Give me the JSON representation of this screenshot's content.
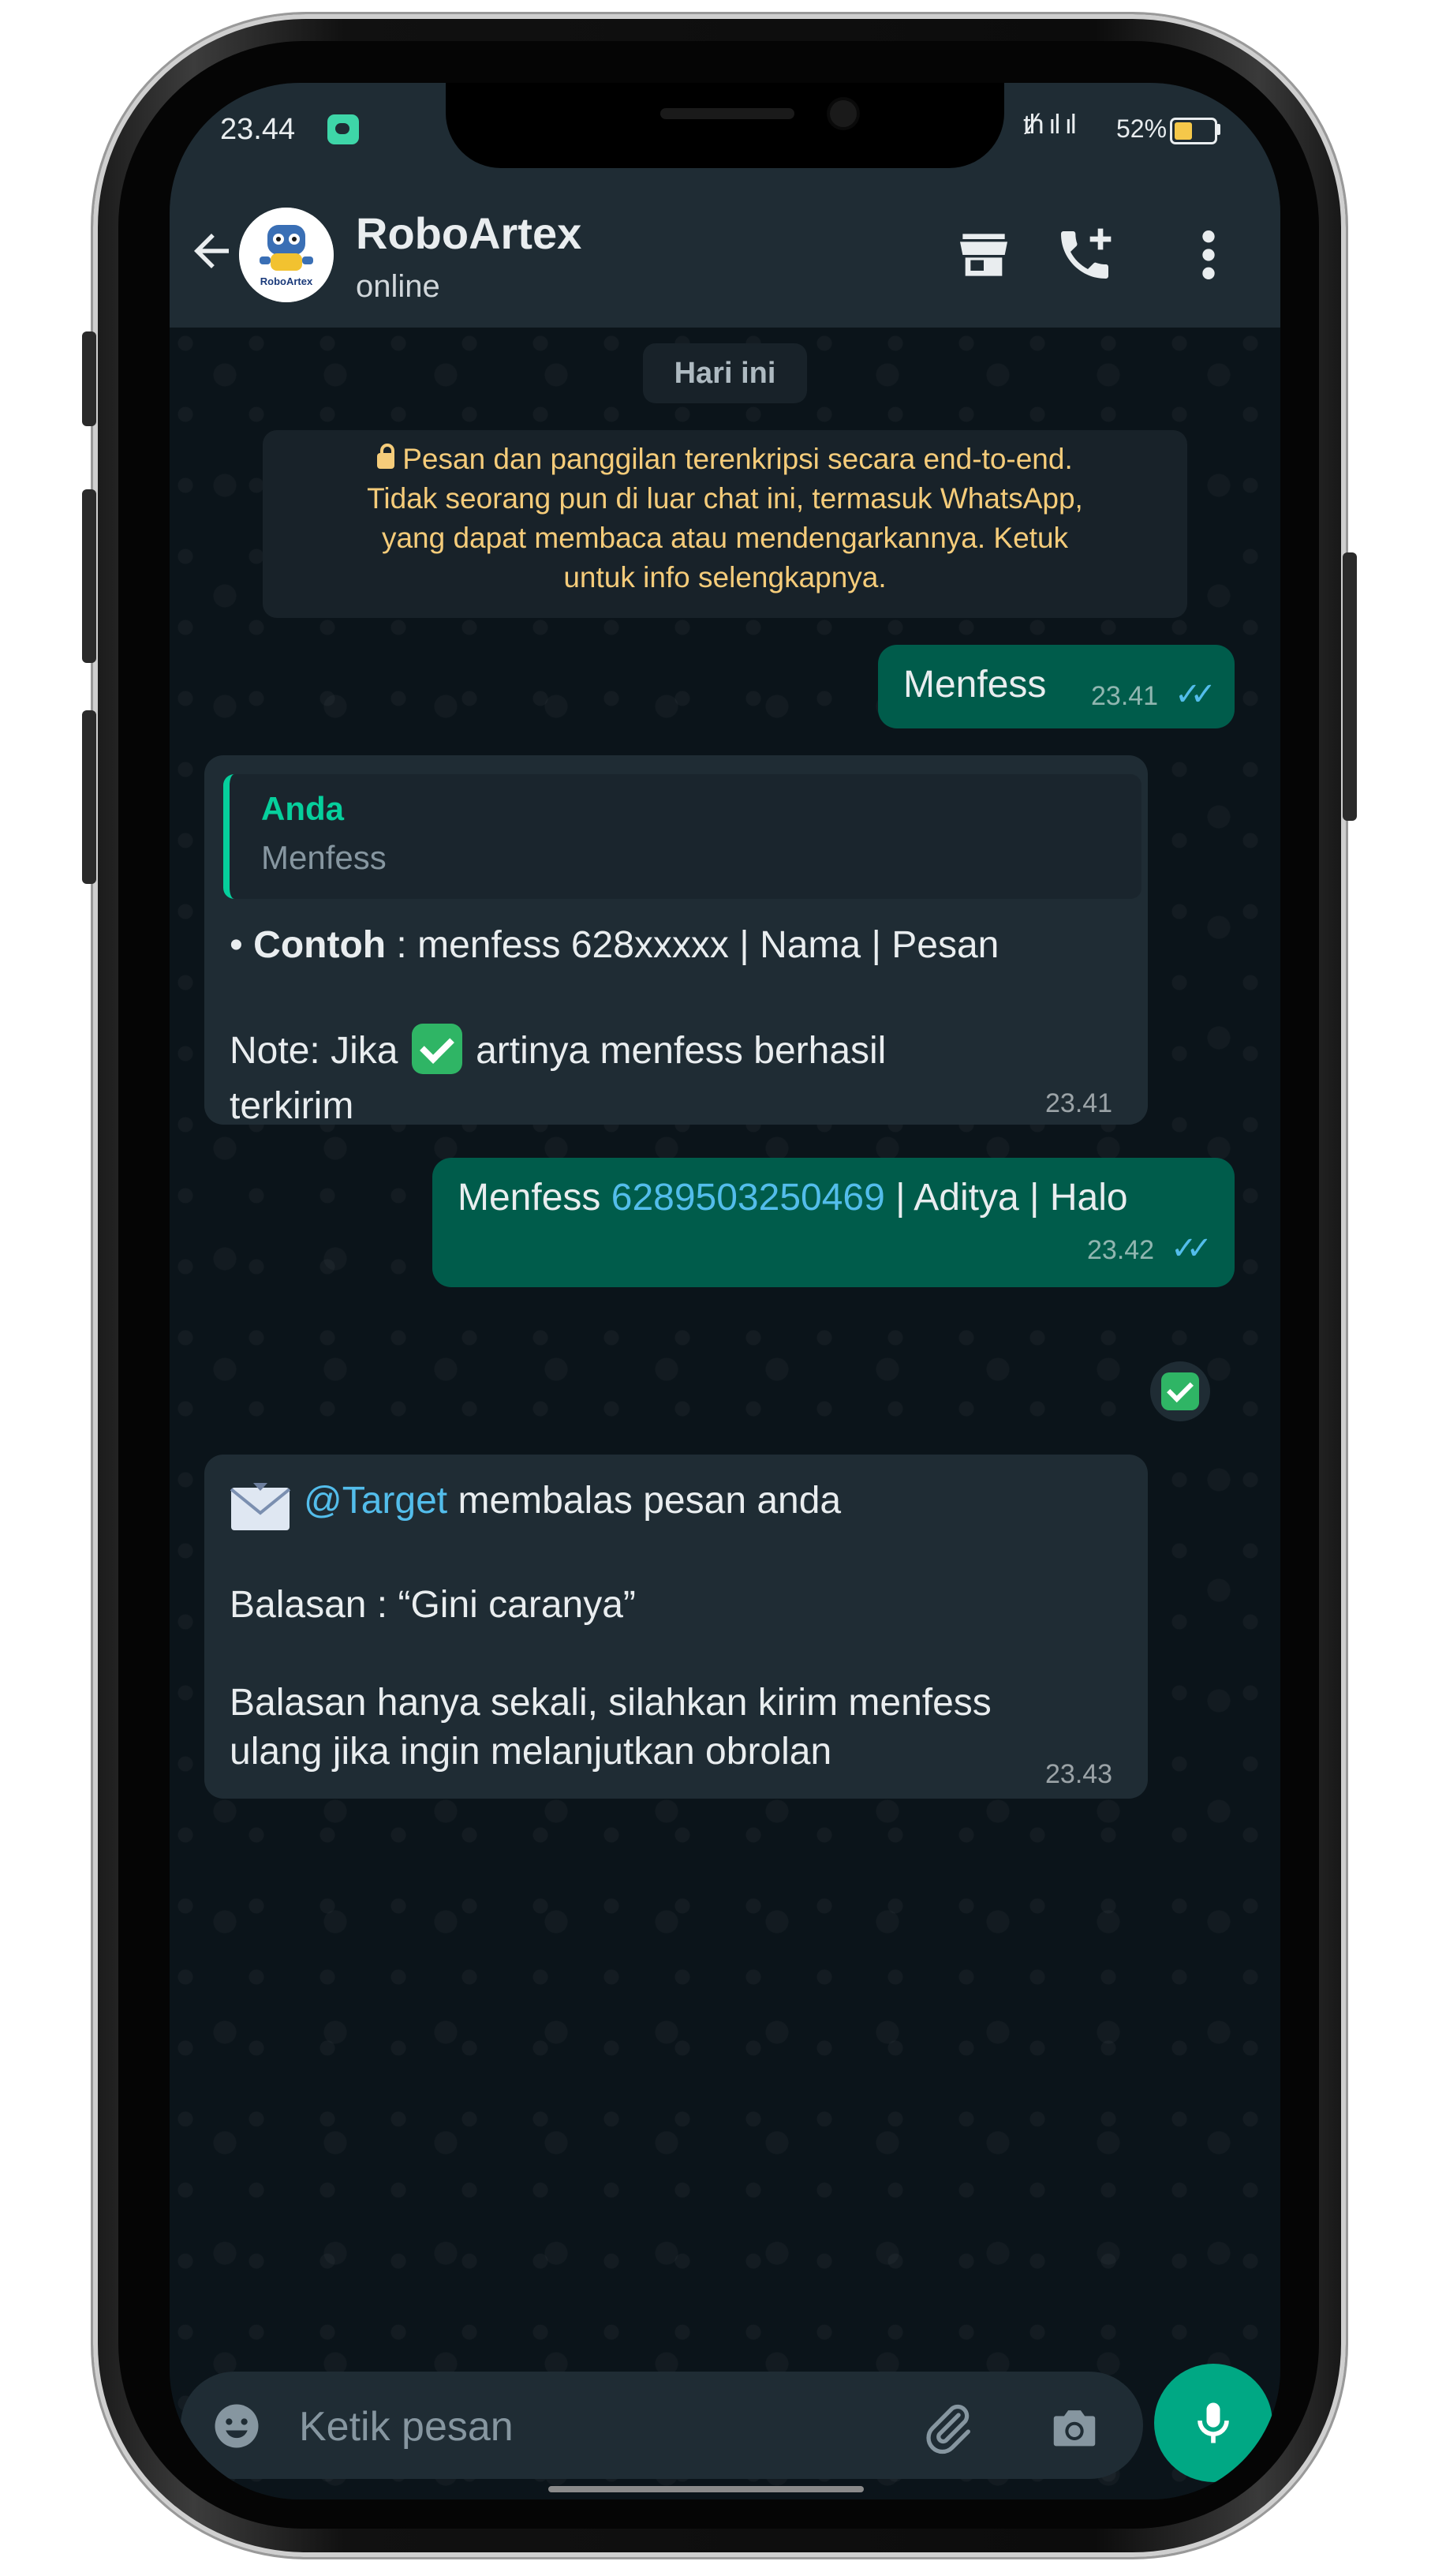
{
  "status_bar": {
    "time": "23.44",
    "signal": "ᵺ ıl ıl",
    "battery": "52%"
  },
  "header": {
    "contact_name": "RoboArtex",
    "status": "online",
    "avatar_label": "RoboArtex"
  },
  "chat": {
    "date_chip": "Hari ini",
    "encryption_notice_lines": [
      "Pesan dan panggilan terenkripsi secara end-to-end.",
      "Tidak seorang pun di luar chat ini, termasuk WhatsApp,",
      "yang dapat membaca atau mendengarkannya. Ketuk",
      "untuk info selengkapnya."
    ],
    "msg1": {
      "text": "Menfess",
      "time": "23.41"
    },
    "msg2": {
      "quote_author": "Anda",
      "quote_text": "Menfess",
      "bullet": "•",
      "example_label": "Contoh",
      "example_text": " : menfess 628xxxxx | Nama | Pesan",
      "note_before": "Note: Jika ",
      "note_after": " artinya menfess berhasil",
      "note_line2": "terkirim",
      "time": "23.41"
    },
    "msg3": {
      "prefix": "Menfess ",
      "phone": "6289503250469",
      "suffix": " | Aditya | Halo",
      "time": "23.42"
    },
    "msg4": {
      "mention": "@Target",
      "line1_rest": " membalas pesan anda",
      "line2": "Balasan : “Gini caranya”",
      "line3": "Balasan hanya sekali, silahkan kirim menfess",
      "line4": "ulang jika ingin melanjutkan obrolan",
      "time": "23.43"
    }
  },
  "input": {
    "placeholder": "Ketik pesan"
  },
  "colors": {
    "background": "#0b141a",
    "header": "#1f2c34",
    "outgoing_bubble": "#005c4b",
    "incoming_bubble": "#1f2c34",
    "accent": "#00a884",
    "read_ticks": "#53bdeb",
    "notice_text": "#f5cc7a"
  },
  "icons": [
    "back-arrow-icon",
    "store-icon",
    "call-add-icon",
    "more-vert-icon",
    "emoji-icon",
    "attach-icon",
    "camera-icon",
    "mic-icon",
    "lock-icon",
    "envelope-icon",
    "check-mark-icon"
  ]
}
